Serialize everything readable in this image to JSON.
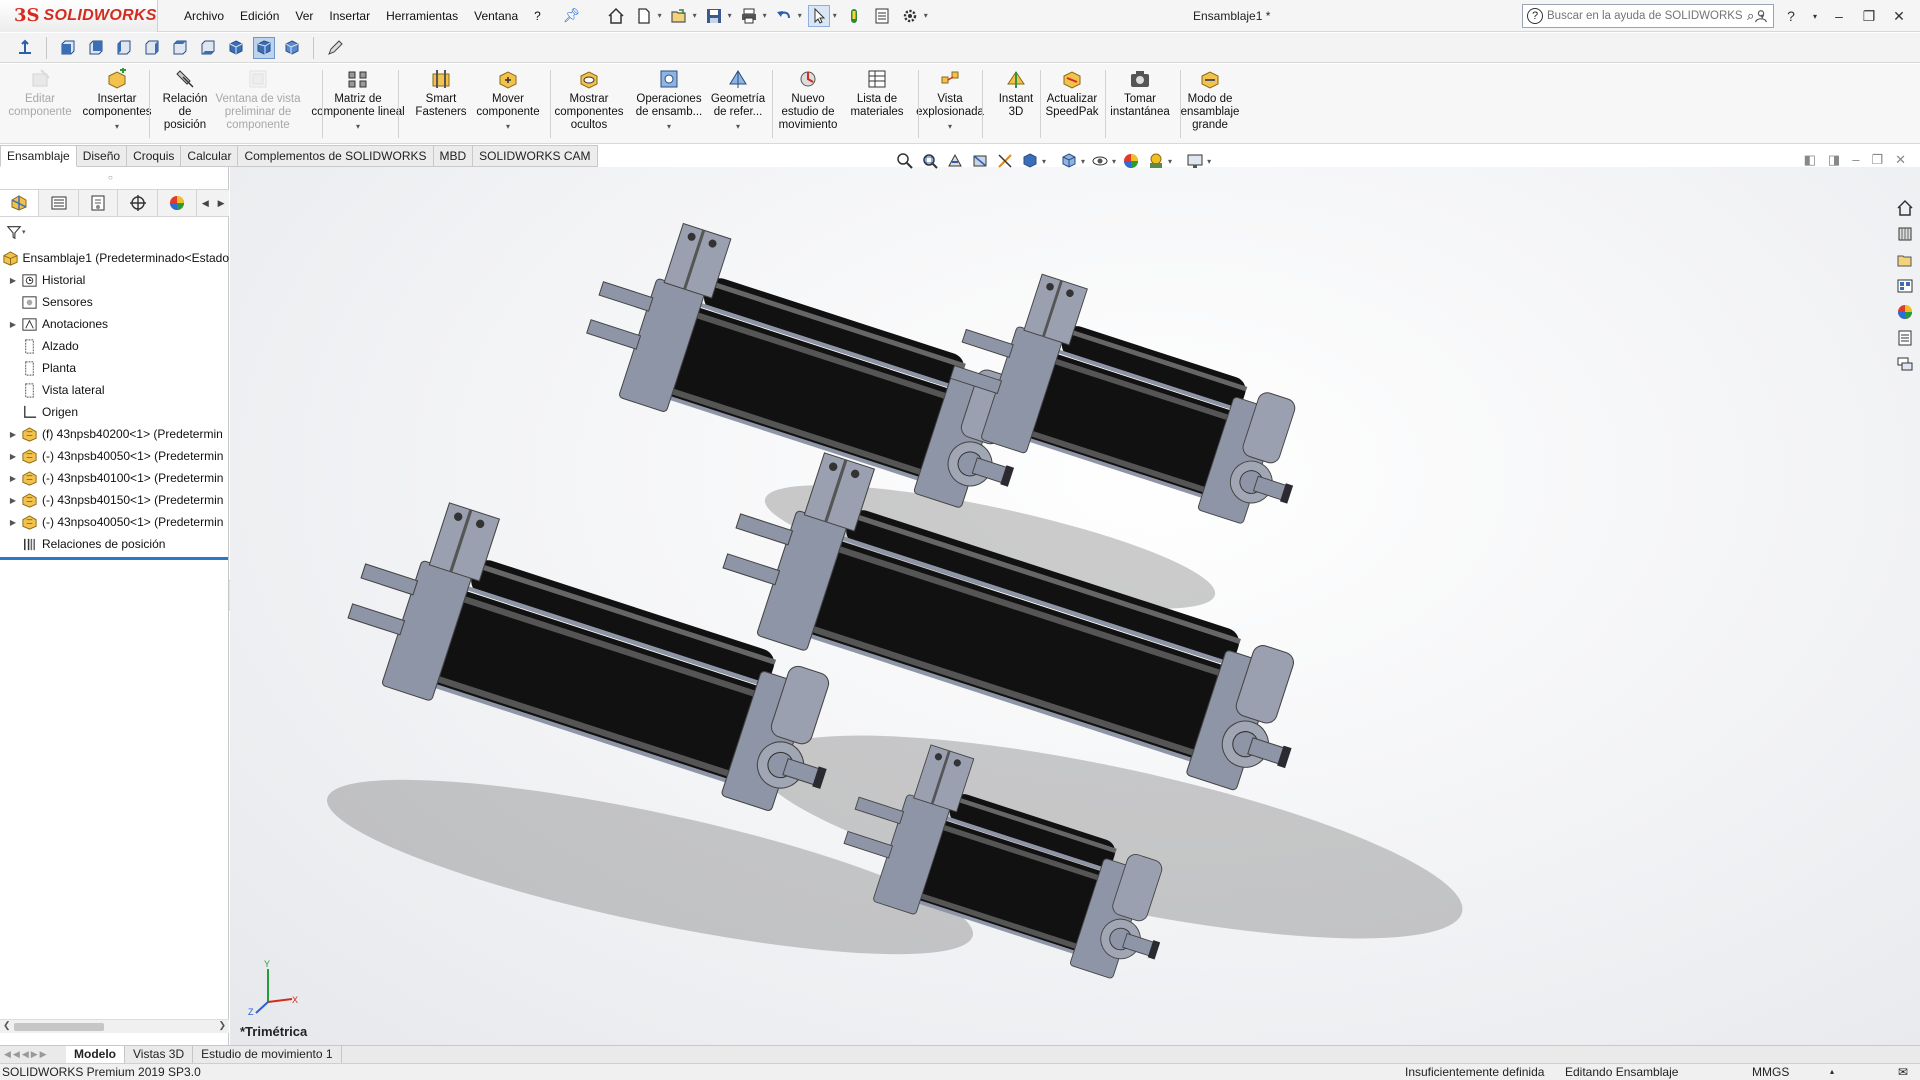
{
  "app": {
    "brand": "SOLIDWORKS",
    "brand_mark": "3S",
    "document_title": "Ensamblaje1 *"
  },
  "menu": [
    "Archivo",
    "Edición",
    "Ver",
    "Insertar",
    "Herramientas",
    "Ventana",
    "?"
  ],
  "help_search": {
    "placeholder": "Buscar en la ayuda de SOLIDWORKS"
  },
  "command_manager": [
    {
      "label": "Editar\ncomponente",
      "disabled": true
    },
    {
      "label": "Insertar\ncomponentes",
      "disabled": false
    },
    {
      "label": "Relación\nde\nposición",
      "disabled": false
    },
    {
      "label": "Ventana de vista\npreliminar de\ncomponente",
      "disabled": true
    },
    {
      "label": "Matriz de\ncomponente lineal",
      "disabled": false
    },
    {
      "label": "Smart\nFasteners",
      "disabled": false
    },
    {
      "label": "Mover\ncomponente",
      "disabled": false
    },
    {
      "label": "Mostrar\ncomponentes\nocultos",
      "disabled": false
    },
    {
      "label": "Operaciones\nde ensamb...",
      "disabled": false
    },
    {
      "label": "Geometría\nde refer...",
      "disabled": false
    },
    {
      "label": "Nuevo\nestudio de\nmovimiento",
      "disabled": false
    },
    {
      "label": "Lista de\nmateriales",
      "disabled": false
    },
    {
      "label": "Vista\nexplosionada",
      "disabled": false
    },
    {
      "label": "Instant\n3D",
      "disabled": false
    },
    {
      "label": "Actualizar\nSpeedPak",
      "disabled": false
    },
    {
      "label": "Tomar\ninstantánea",
      "disabled": false
    },
    {
      "label": "Modo de\nensamblaje\ngrande",
      "disabled": false
    }
  ],
  "tabs": [
    "Ensamblaje",
    "Diseño",
    "Croquis",
    "Calcular",
    "Complementos de SOLIDWORKS",
    "MBD",
    "SOLIDWORKS CAM"
  ],
  "active_tab": "Ensamblaje",
  "tree": {
    "root": "Ensamblaje1  (Predeterminado<Estado",
    "items": [
      {
        "label": "Historial",
        "expandable": true,
        "icon": "history-folder-icon"
      },
      {
        "label": "Sensores",
        "expandable": false,
        "icon": "sensor-folder-icon"
      },
      {
        "label": "Anotaciones",
        "expandable": true,
        "icon": "annotation-folder-icon"
      },
      {
        "label": "Alzado",
        "expandable": false,
        "icon": "plane-icon"
      },
      {
        "label": "Planta",
        "expandable": false,
        "icon": "plane-icon"
      },
      {
        "label": "Vista lateral",
        "expandable": false,
        "icon": "plane-icon"
      },
      {
        "label": "Origen",
        "expandable": false,
        "icon": "origin-icon"
      },
      {
        "label": "(f) 43npsb40200<1> (Predetermin",
        "expandable": true,
        "icon": "subassembly-icon"
      },
      {
        "label": "(-) 43npsb40050<1> (Predetermin",
        "expandable": true,
        "icon": "subassembly-icon"
      },
      {
        "label": "(-) 43npsb40100<1> (Predetermin",
        "expandable": true,
        "icon": "subassembly-icon"
      },
      {
        "label": "(-) 43npsb40150<1> (Predetermin",
        "expandable": true,
        "icon": "subassembly-icon"
      },
      {
        "label": "(-) 43npso40050<1> (Predetermin",
        "expandable": true,
        "icon": "subassembly-icon"
      },
      {
        "label": "Relaciones de posición",
        "expandable": false,
        "icon": "mates-folder-icon"
      }
    ]
  },
  "viewport": {
    "view_name": "*Trimétrica"
  },
  "bottom_tabs": [
    "Modelo",
    "Vistas 3D",
    "Estudio de movimiento 1"
  ],
  "active_bottom_tab": "Modelo",
  "status": {
    "product": "SOLIDWORKS Premium 2019 SP3.0",
    "definition": "Insuficientemente definida",
    "mode": "Editando Ensamblaje",
    "units": "MMGS"
  },
  "colors": {
    "brand": "#d52b1e",
    "accent": "#2a6fd8",
    "cylinder_body": "#111111",
    "cylinder_metal": "#8e95a6"
  }
}
